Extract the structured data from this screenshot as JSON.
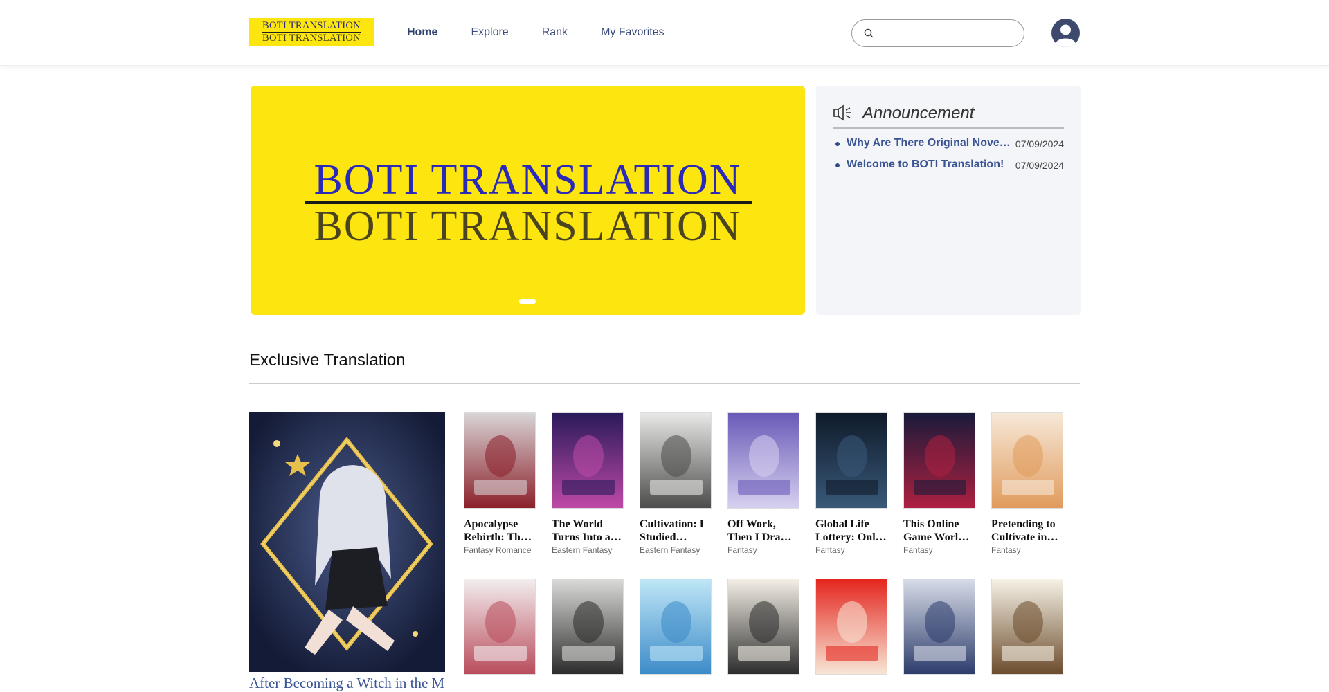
{
  "header": {
    "logo_line1": "BOTI TRANSLATION",
    "logo_line2": "BOTI TRANSLATION",
    "nav": [
      {
        "label": "Home",
        "active": true
      },
      {
        "label": "Explore",
        "active": false
      },
      {
        "label": "Rank",
        "active": false
      },
      {
        "label": "My Favorites",
        "active": false
      }
    ],
    "search_placeholder": "",
    "search_icon": "search-icon",
    "avatar_icon": "user-icon"
  },
  "banner": {
    "line1": "BOTI TRANSLATION",
    "line2": "BOTI TRANSLATION",
    "background": "#fde50f"
  },
  "announcement": {
    "title": "Announcement",
    "icon": "speaker-icon",
    "items": [
      {
        "title": "Why Are There Original Novels on BOTI Translation?",
        "date": "07/09/2024"
      },
      {
        "title": "Welcome to BOTI Translation!",
        "date": "07/09/2024"
      }
    ]
  },
  "section": {
    "title": "Exclusive Translation",
    "featured_title": "After Becoming a Witch in the Magic World"
  },
  "books_row1": [
    {
      "title": "Apocalypse Rebirth: The Big Shot Starts With Millions of Supplies",
      "genre": "Fantasy Romance",
      "cover": [
        "#d8d4d6",
        "#8a1e28"
      ]
    },
    {
      "title": "The World Turns Into a Game",
      "genre": "Eastern Fantasy",
      "cover": [
        "#2a1a5a",
        "#c04aa8"
      ]
    },
    {
      "title": "Cultivation: I Studied Abroad in Modern Times",
      "genre": "Eastern Fantasy",
      "cover": [
        "#e8e8e6",
        "#4a4a48"
      ]
    },
    {
      "title": "Off Work, Then I Draw a Card",
      "genre": "Fantasy",
      "cover": [
        "#6a5ab8",
        "#d8d2f0"
      ]
    },
    {
      "title": "Global Life Lottery: Only I Can Designate Rewards",
      "genre": "Fantasy",
      "cover": [
        "#0f1a2a",
        "#3a5a7a"
      ]
    },
    {
      "title": "This Online Game World Is Too Real",
      "genre": "Fantasy",
      "cover": [
        "#1a1a3a",
        "#b02040"
      ]
    },
    {
      "title": "Pretending to Cultivate in Kindergarten",
      "genre": "Fantasy",
      "cover": [
        "#f6e8d8",
        "#e09a5a"
      ]
    }
  ],
  "books_row2": [
    {
      "cover": [
        "#f2eeee",
        "#b84a5a"
      ]
    },
    {
      "cover": [
        "#dadad8",
        "#2a2a2a"
      ]
    },
    {
      "cover": [
        "#bfe6f6",
        "#3a8ac8"
      ]
    },
    {
      "cover": [
        "#f4efe6",
        "#2a2a2a"
      ]
    },
    {
      "cover": [
        "#e4261e",
        "#f8e8d8"
      ]
    },
    {
      "cover": [
        "#d8dce8",
        "#2a3a6a"
      ]
    },
    {
      "cover": [
        "#f6f2e6",
        "#6a4a2a"
      ]
    }
  ]
}
